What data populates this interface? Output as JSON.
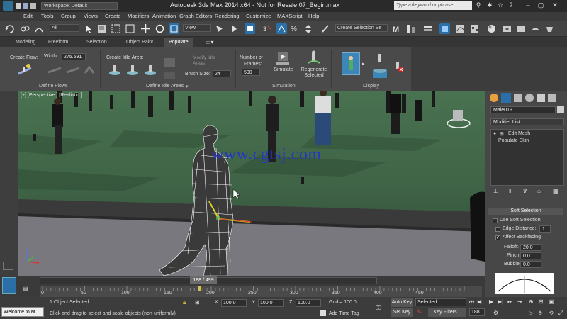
{
  "titlebar": {
    "workspace": "Workspace: Default",
    "title": "Autodesk 3ds Max  2014 x64  - Not for Resale   07_Begin.max",
    "search_placeholder": "Type a keyword or phrase"
  },
  "menu": [
    "Edit",
    "Tools",
    "Group",
    "Views",
    "Create",
    "Modifiers",
    "Animation",
    "Graph Editors",
    "Rendering",
    "Customize",
    "MAXScript",
    "Help"
  ],
  "toolbar": {
    "filter_select": "All",
    "view_select": "View",
    "selection_set": "Create Selection Se"
  },
  "ribbon_tabs": [
    "Modeling",
    "Freeform",
    "Selection",
    "Object Paint",
    "Populate"
  ],
  "ribbon": {
    "create_flow": "Create Flow:",
    "width_label": "Width:",
    "width_value": "275.591",
    "define_flows": "Define Flows",
    "create_idle_area": "Create Idle Area:",
    "modify_idle_areas": "Modify Idle Areas",
    "brush_size_label": "Brush Size:",
    "brush_size_value": "24",
    "define_idle_areas": "Define Idle Areas",
    "number_of_frames_1": "Number of",
    "number_of_frames_2": "Frames:",
    "frames_value": "500",
    "simulate": "Simulate",
    "regenerate_1": "Regenerate",
    "regenerate_2": "Selected",
    "simulation": "Simulation",
    "display": "Display"
  },
  "viewport": {
    "label": "[+] [Perspective ] [Realistic ]",
    "watermark": "www.cgtsj.com"
  },
  "command_panel": {
    "object_name": "Male019",
    "modifier_list": "Modifier List",
    "stack": [
      "Edit Mesh",
      "Populate Skin"
    ],
    "rollout_title": "Soft Selection",
    "use_soft_selection": "Use Soft Selection",
    "edge_distance": "Edge Distance:",
    "edge_distance_value": "1",
    "affect_backfacing": "Affect Backfacing",
    "falloff_label": "Falloff:",
    "falloff_value": "20.0",
    "pinch_label": "Pinch:",
    "pinch_value": "0.0",
    "bubble_label": "Bubble:",
    "bubble_value": "0.0"
  },
  "timeline": {
    "frame_indicator": "188 / 499",
    "ticks": [
      "0",
      "50",
      "100",
      "150",
      "200",
      "250",
      "300",
      "350",
      "400",
      "450"
    ]
  },
  "statusbar": {
    "script_listener": "Welcome to M",
    "selected": "1 Object Selected",
    "prompt": "Click and drag to select and scale objects (non-uniformly)",
    "x_label": "X:",
    "x_value": "100.0",
    "y_label": "Y:",
    "y_value": "100.0",
    "z_label": "Z:",
    "z_value": "100.0",
    "grid": "Grid = 100.0",
    "add_time_tag": "Add Time Tag",
    "auto_key": "Auto Key",
    "auto_key_select": "Selected",
    "set_key": "Set Key",
    "key_filters": "Key Filters...",
    "current_frame": "188"
  }
}
